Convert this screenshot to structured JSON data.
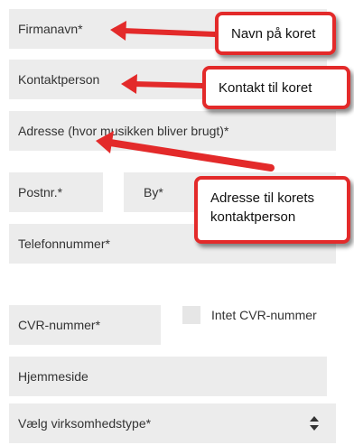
{
  "form": {
    "company_name_label": "Firmanavn*",
    "contact_person_label": "Kontaktperson",
    "address_label": "Adresse (hvor musikken bliver brugt)*",
    "postal_code_label": "Postnr.*",
    "city_label": "By*",
    "phone_label": "Telefonnummer*",
    "cvr_label": "CVR-nummer*",
    "no_cvr_label": "Intet CVR-nummer",
    "website_label": "Hjemmeside",
    "business_type_label": "Vælg virksomhedstype*"
  },
  "annotations": {
    "choir_name": "Navn på koret",
    "choir_contact": "Kontakt til koret",
    "choir_address_line1": "Adresse til korets",
    "choir_address_line2": "kontaktperson"
  },
  "colors": {
    "field_background": "#ececec",
    "annotation_red": "#e32a2a"
  }
}
